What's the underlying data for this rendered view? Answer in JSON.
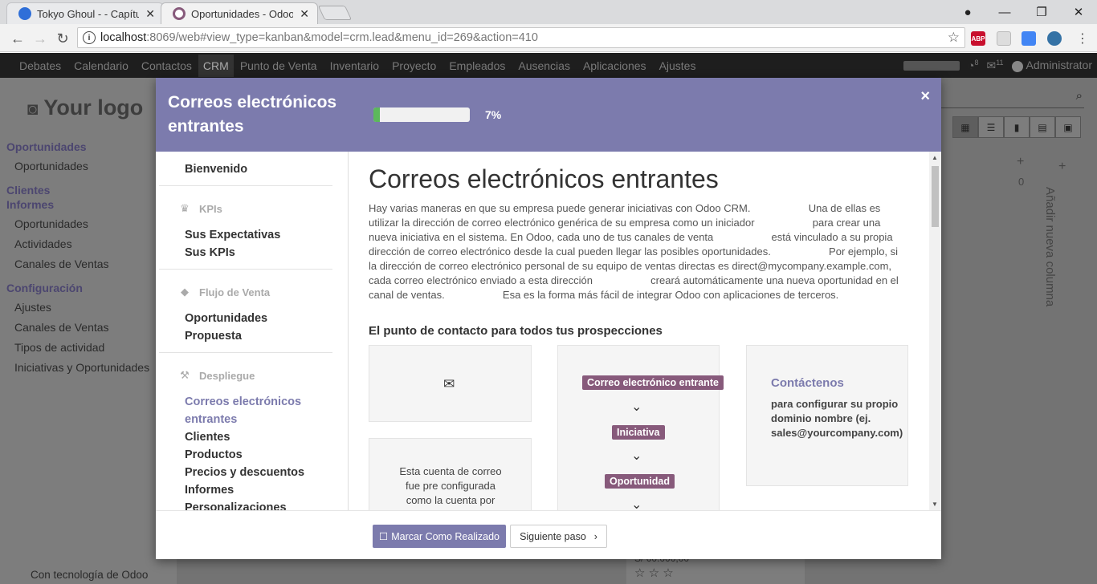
{
  "browser": {
    "tabs": [
      {
        "title": "Tokyo Ghoul - - Capítulo",
        "favicon_color": "#2f6fd8"
      },
      {
        "title": "Oportunidades - Odoo",
        "favicon_color": "#875a7b"
      }
    ],
    "url_host": "localhost",
    "url_path": ":8069/web#view_type=kanban&model=crm.lead&menu_id=269&action=410",
    "extensions": [
      "ABP"
    ]
  },
  "odoo_nav": {
    "items": [
      "Debates",
      "Calendario",
      "Contactos",
      "CRM",
      "Punto de Venta",
      "Inventario",
      "Proyecto",
      "Empleados",
      "Ausencias",
      "Aplicaciones",
      "Ajustes"
    ],
    "active": "CRM",
    "badge_1": "8",
    "badge_2": "11",
    "user": "Administrator"
  },
  "sidebar": {
    "logo": "Your logo",
    "sections": [
      {
        "label": "Oportunidades"
      },
      {
        "label": "Oportunidades"
      },
      {
        "label": "Clientes"
      },
      {
        "label": "Informes"
      },
      {
        "label": "Oportunidades"
      },
      {
        "label": "Actividades"
      },
      {
        "label": "Canales de Ventas"
      },
      {
        "label": "Configuración"
      },
      {
        "label": "Ajustes"
      },
      {
        "label": "Canales de Ventas"
      },
      {
        "label": "Tipos de actividad"
      },
      {
        "label": "Iniciativas y Oportunidades"
      }
    ],
    "powered_by": "Con tecnología de Odoo"
  },
  "kanban": {
    "add_column": "Añadir nueva columna",
    "count": "0",
    "amount": "S/ 60.000,00"
  },
  "modal": {
    "title": "Correos electrónicos entrantes",
    "progress_percent": 7,
    "progress_label": "7%",
    "close_label": "×",
    "nav": {
      "welcome": "Bienvenido",
      "cat_kpis": "KPIs",
      "expectations": "Sus Expectativas",
      "kpis": "Sus KPIs",
      "cat_flow": "Flujo de Venta",
      "opportunities": "Oportunidades",
      "proposal": "Propuesta",
      "cat_deploy": "Despliegue",
      "incoming_1": "Correos electrónicos",
      "incoming_2": "entrantes",
      "customers": "Clientes",
      "products": "Productos",
      "pricing": "Precios y descuentos",
      "reports": "Informes",
      "customizations": "Personalizaciones"
    },
    "content": {
      "heading": "Correos electrónicos entrantes",
      "paragraph": "Hay varias maneras en que su empresa puede generar iniciativas con Odoo CRM.                    Una de ellas es utilizar la dirección de correo electrónico genérica de su empresa como un iniciador                    para crear una nueva iniciativa en el sistema. En Odoo, cada uno de tus canales de venta                    está vinculado a su propia dirección de correo electrónico desde la cual pueden llegar las posibles oportunidades.                    Por ejemplo, si la dirección de correo electrónico personal de su equipo de ventas directas es direct@mycompany.example.com, cada correo electrónico enviado a esta dirección                    creará automáticamente una nueva oportunidad en el canal de ventas.                    Esa es la forma más fácil de integrar Odoo con aplicaciones de terceros.",
      "subheading": "El punto de contacto para todos tus prospecciones",
      "card_text": "Esta cuenta de correo fue pre configurada como la cuenta por defecto",
      "flow": [
        "Correo electrónico entrante",
        "Iniciativa",
        "Oportunidad"
      ],
      "contact_title": "Contáctenos",
      "contact_text": "para configurar su propio dominio nombre (ej. sales@yourcompany.com)"
    },
    "footer": {
      "done": "Marcar Como Realizado",
      "next": "Siguiente paso"
    }
  }
}
